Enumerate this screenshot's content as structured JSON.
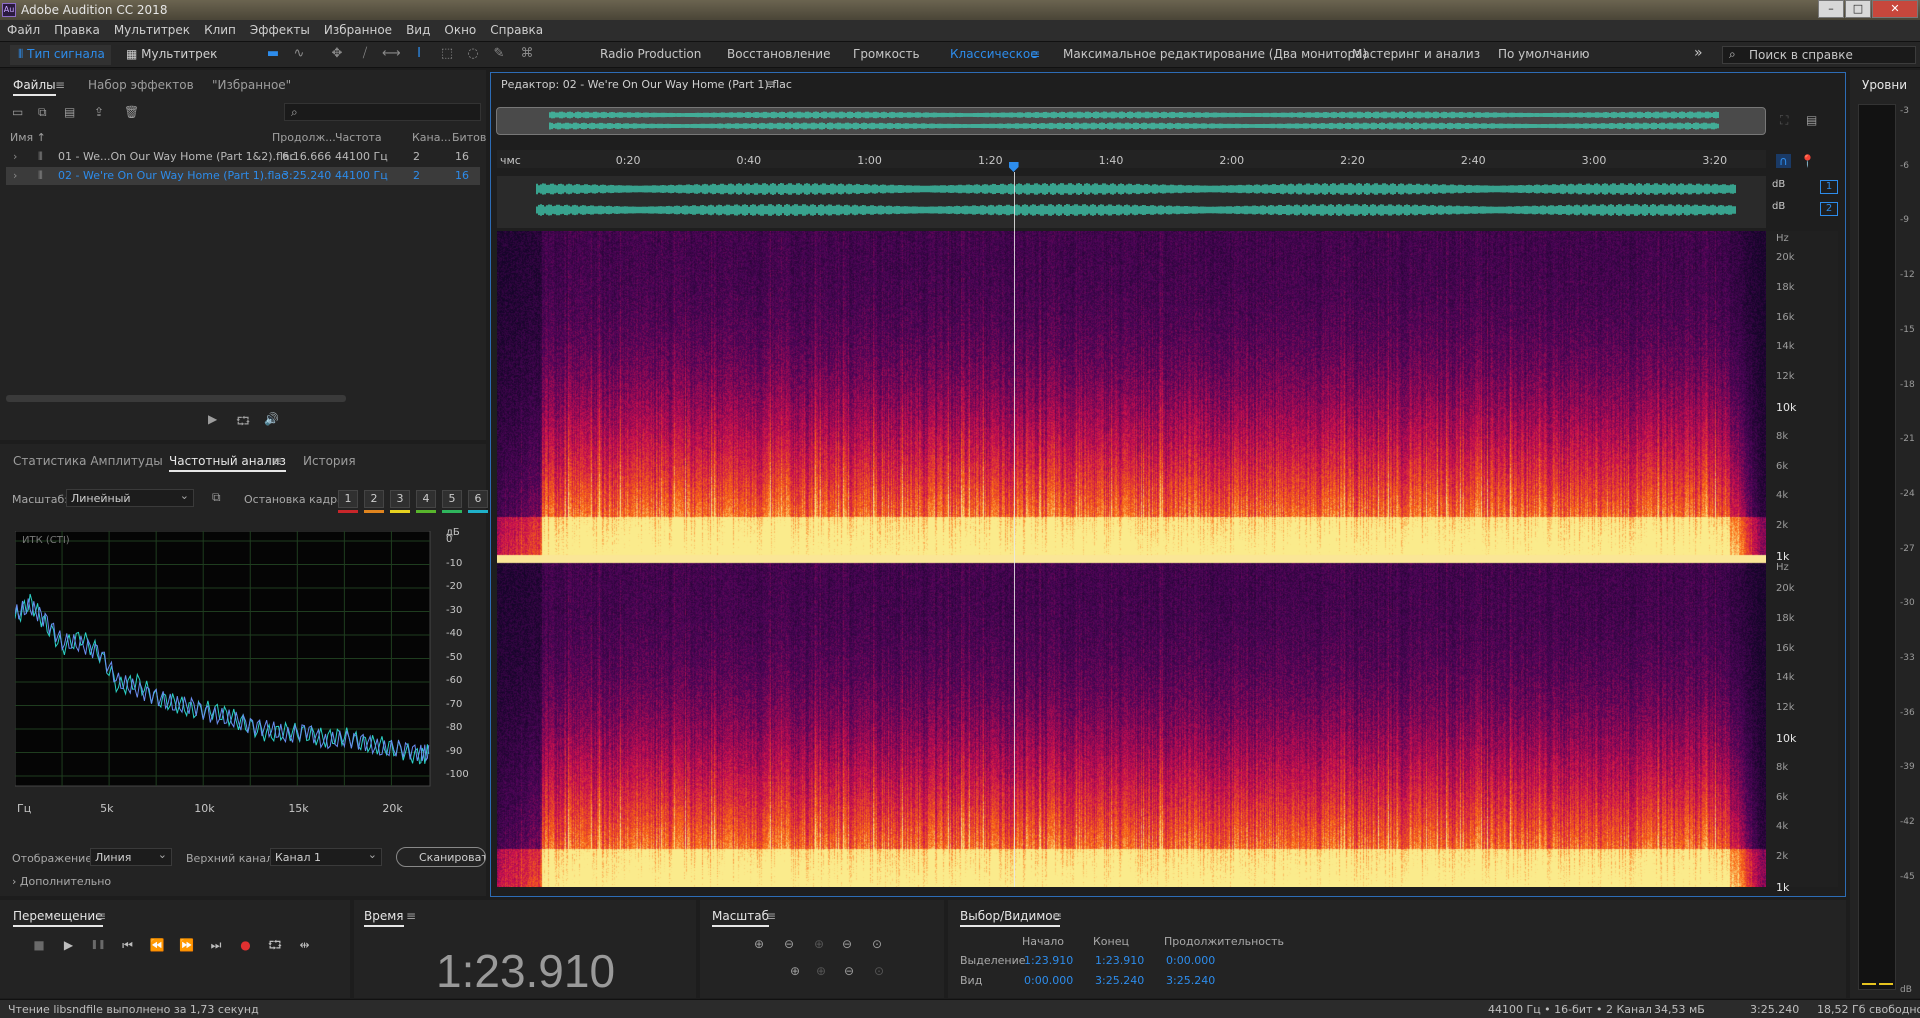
{
  "app": {
    "title": "Adobe Audition CC 2018",
    "icon_text": "Au"
  },
  "window_controls": [
    "minimize-icon",
    "maximize-icon",
    "close-icon"
  ],
  "menu": [
    "Файл",
    "Правка",
    "Мультитрек",
    "Клип",
    "Эффекты",
    "Избранное",
    "Вид",
    "Окно",
    "Справка"
  ],
  "toolbar": {
    "mode_waveform": "Тип сигнала",
    "mode_multitrack": "Мультитрек",
    "workspaces": [
      "Radio Production",
      "Восстановление",
      "Громкость",
      "Классическое",
      "Максимальное редактирование (Два монитора)",
      "Мастеринг и анализ",
      "По умолчанию"
    ],
    "active_workspace": "Классическое",
    "help_search_placeholder": "Поиск в справке",
    "more": "»"
  },
  "files_panel": {
    "tabs": [
      "Файлы",
      "Набор эффектов",
      "\"Избранное\""
    ],
    "search_icon": "⌕",
    "columns": [
      "Имя",
      "Продолж...",
      "Частота",
      "Кана...",
      "Битов"
    ],
    "rows": [
      {
        "name": "01 - We...On Our Way Home (Part 1&2).flac",
        "duration": "6:16.666",
        "rate": "44100 Гц",
        "channels": "2",
        "bits": "16",
        "selected": false
      },
      {
        "name": "02 - We're On Our Way Home (Part 1).flac",
        "duration": "3:25.240",
        "rate": "44100 Гц",
        "channels": "2",
        "bits": "16",
        "selected": true
      }
    ]
  },
  "analysis_panel": {
    "tabs": [
      "Статистика Амплитуды",
      "Частотный анализ",
      "История"
    ],
    "scale_label": "Масштаб:",
    "scale_value": "Линейный",
    "freeze_label": "Остановка кадра:",
    "freeze_slots": [
      "1",
      "2",
      "3",
      "4",
      "5",
      "6"
    ],
    "freeze_colors": [
      "#c8262a",
      "#e0841e",
      "#e6d21f",
      "#58b52c",
      "#2fb55d",
      "#1fb1c9"
    ],
    "plot_tag": "ИТК (CTI)",
    "y_unit": "дБ",
    "display_label": "Отображение:",
    "display_value": "Линия",
    "channel_label": "Верхний канал:",
    "channel_value": "Канал 1",
    "scan_button": "Сканировать",
    "advanced": "Дополнительно"
  },
  "chart_data": {
    "type": "line",
    "title": "",
    "xlabel": "",
    "ylabel": "дБ",
    "x_ticks": [
      "Гц",
      "5k",
      "10k",
      "15k",
      "20k"
    ],
    "xlim": [
      0,
      22050
    ],
    "y_ticks": [
      "0",
      "-10",
      "-20",
      "-30",
      "-40",
      "-50",
      "-60",
      "-70",
      "-80",
      "-90",
      "-100"
    ],
    "ylim": [
      -100,
      0
    ],
    "grid": true,
    "series": [
      {
        "x": [
          0,
          800,
          1600,
          2500,
          3500,
          4500,
          5500,
          6500,
          7500,
          8500,
          9500,
          10500,
          11500,
          12500,
          13500,
          14500,
          15500,
          16500,
          17500,
          18500,
          19500,
          20500,
          21500,
          22050
        ],
        "y": [
          -33,
          -26,
          -35,
          -45,
          -41,
          -48,
          -62,
          -60,
          -67,
          -69,
          -72,
          -72,
          -75,
          -79,
          -82,
          -81,
          -82,
          -84,
          -83,
          -86,
          -87,
          -89,
          -92,
          -90
        ],
        "color": "#2bd2c6"
      },
      {
        "x": [
          0,
          800,
          1600,
          2500,
          3500,
          4500,
          5500,
          6500,
          7500,
          8500,
          9500,
          10500,
          11500,
          12500,
          13500,
          14500,
          15500,
          16500,
          17500,
          18500,
          19500,
          20500,
          21500,
          22050
        ],
        "y": [
          -31,
          -28,
          -33,
          -43,
          -44,
          -47,
          -60,
          -63,
          -66,
          -70,
          -70,
          -74,
          -76,
          -78,
          -80,
          -83,
          -80,
          -86,
          -84,
          -85,
          -89,
          -88,
          -90,
          -91
        ],
        "color": "#6a8df0"
      }
    ]
  },
  "editor": {
    "title": "Редактор: 02 - We're On Our Way Home (Part 1).flac",
    "time_unit": "чмс",
    "time_ticks": [
      "0:20",
      "0:40",
      "1:00",
      "1:20",
      "1:40",
      "2:00",
      "2:20",
      "2:40",
      "3:00",
      "3:20"
    ],
    "total_seconds": 205.24,
    "playhead_seconds": 83.91,
    "waveform_color": "#3fd6b8",
    "db_label": "dB",
    "channel_numbers": [
      "1",
      "2"
    ],
    "hz_label": "Hz",
    "freq_ticks": [
      "20k",
      "18k",
      "16k",
      "14k",
      "12k",
      "10k",
      "8k",
      "6k",
      "4k",
      "2k",
      "1k"
    ]
  },
  "levels_panel": {
    "title": "Уровни",
    "unit": "dB",
    "ticks": [
      "-3",
      "-6",
      "-9",
      "-12",
      "-15",
      "-18",
      "-21",
      "-24",
      "-27",
      "-30",
      "-33",
      "-36",
      "-39",
      "-42",
      "-45"
    ]
  },
  "transport": {
    "title": "Перемещение",
    "buttons": [
      "stop-icon",
      "play-icon",
      "pause-icon",
      "go-to-start-icon",
      "rewind-icon",
      "fast-forward-icon",
      "go-to-end-icon",
      "record-icon",
      "loop-icon",
      "skip-selection-icon"
    ]
  },
  "time_panel": {
    "title": "Время",
    "value": "1:23.910"
  },
  "zoom_panel": {
    "title": "Масштаб"
  },
  "selection_panel": {
    "title": "Выбор/Видимое",
    "col_start": "Начало",
    "col_end": "Конец",
    "col_duration": "Продолжительность",
    "selection_label": "Выделение",
    "selection": [
      "1:23.910",
      "1:23.910",
      "0:00.000"
    ],
    "view_label": "Вид",
    "view": [
      "0:00.000",
      "3:25.240",
      "3:25.240"
    ]
  },
  "status": {
    "message": "Чтение libsndfile выполнено за 1,73 секунд",
    "format": "44100 Гц • 16-бит • 2 Канал",
    "size": "34,53 мБ",
    "duration": "3:25.240",
    "free": "18,52 Гб свободно"
  }
}
